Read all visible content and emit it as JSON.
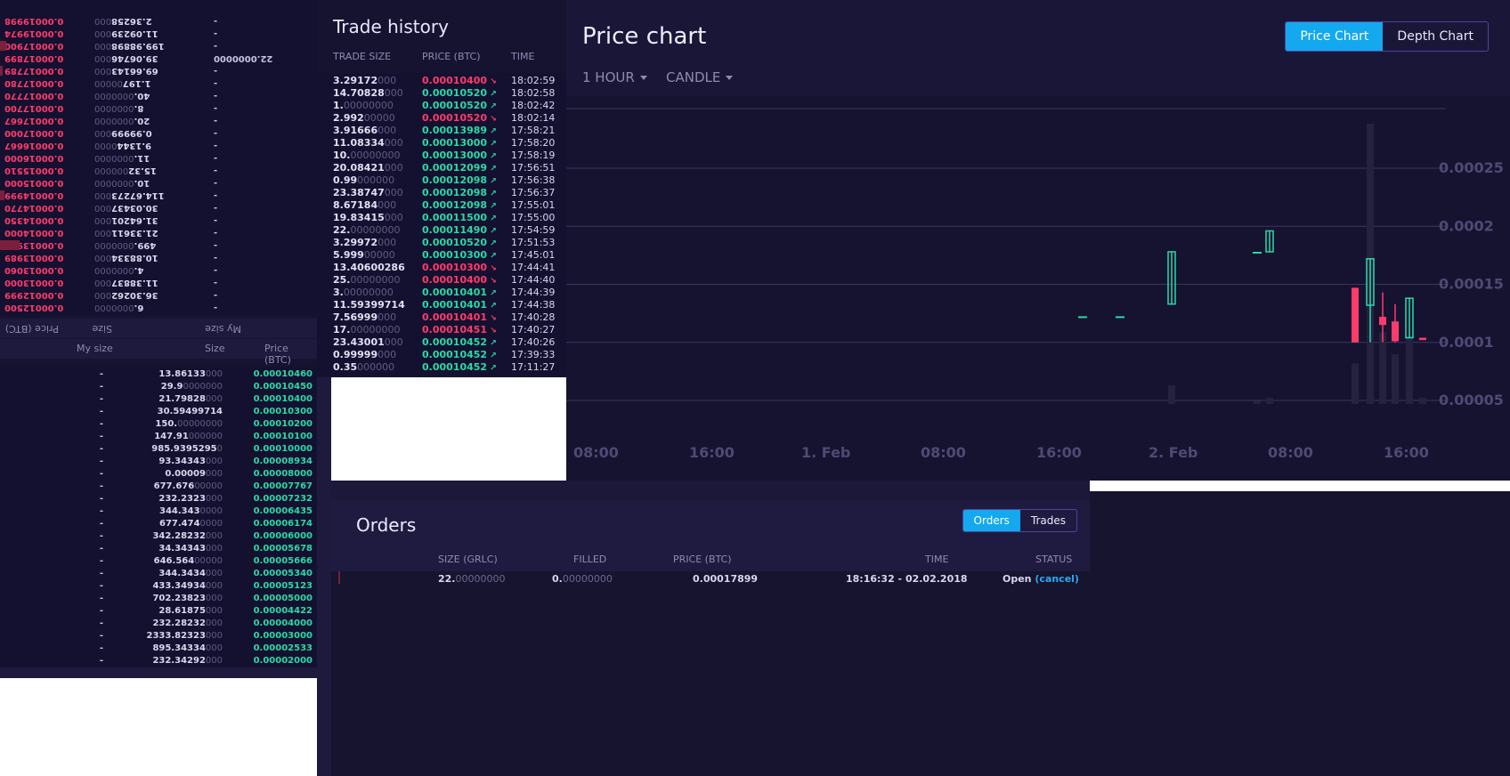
{
  "orderbook": {
    "header_flipped": {
      "price": "Price (BTC)",
      "size": "Size",
      "my_size": "My size"
    },
    "header": {
      "my_size": "My size",
      "size": "Size",
      "price": "Price (BTC)"
    },
    "asks": [
      {
        "my": "-",
        "size_b": "2.36258",
        "size_d": "000",
        "price_b": "0.0001",
        "price_d": "9998"
      },
      {
        "my": "-",
        "size_b": "11.09239",
        "size_d": "000",
        "price_b": "0.0001",
        "price_d": "9974"
      },
      {
        "my": "-",
        "size_b": "199.98898",
        "size_d": "000",
        "price_b": "0.0001",
        "price_d": "7900"
      },
      {
        "my": "22.0000000",
        "size_b": "39.06746",
        "size_d": "000",
        "price_b": "0.0001",
        "price_d": "7899"
      },
      {
        "my": "-",
        "size_b": "69.66143",
        "size_d": "000",
        "price_b": "0.0001",
        "price_d": "7789"
      },
      {
        "my": "-",
        "size_b": "1.197",
        "size_d": "00000",
        "price_b": "0.0001",
        "price_d": "7780"
      },
      {
        "my": "-",
        "size_b": "40.",
        "size_d": "0000000",
        "price_b": "0.0001",
        "price_d": "7770"
      },
      {
        "my": "-",
        "size_b": "8.",
        "size_d": "0000000",
        "price_b": "0.0001",
        "price_d": "7700"
      },
      {
        "my": "-",
        "size_b": "20.",
        "size_d": "0000000",
        "price_b": "0.0001",
        "price_d": "7667"
      },
      {
        "my": "-",
        "size_b": "0.99999",
        "size_d": "000",
        "price_b": "0.0001",
        "price_d": "7000"
      },
      {
        "my": "-",
        "size_b": "9.1344",
        "size_d": "0000",
        "price_b": "0.0001",
        "price_d": "6667"
      },
      {
        "my": "-",
        "size_b": "11.",
        "size_d": "0000000",
        "price_b": "0.0001",
        "price_d": "6000"
      },
      {
        "my": "-",
        "size_b": "15.32",
        "size_d": "000000",
        "price_b": "0.0001",
        "price_d": "5510"
      },
      {
        "my": "-",
        "size_b": "10.",
        "size_d": "0000000",
        "price_b": "0.0001",
        "price_d": "5000"
      },
      {
        "my": "-",
        "size_b": "114.67273",
        "size_d": "000",
        "price_b": "0.0001",
        "price_d": "4999"
      },
      {
        "my": "-",
        "size_b": "30.03437",
        "size_d": "000",
        "price_b": "0.0001",
        "price_d": "4770"
      },
      {
        "my": "-",
        "size_b": "31.64201",
        "size_d": "000",
        "price_b": "0.0001",
        "price_d": "4350"
      },
      {
        "my": "-",
        "size_b": "21.33611",
        "size_d": "000",
        "price_b": "0.0001",
        "price_d": "4000"
      },
      {
        "my": "-",
        "size_b": "499.",
        "size_d": "0000000",
        "price_b": "0.0001",
        "price_d": "3990"
      },
      {
        "my": "-",
        "size_b": "10.88334",
        "size_d": "000",
        "price_b": "0.0001",
        "price_d": "3989"
      },
      {
        "my": "-",
        "size_b": "4.",
        "size_d": "0000000",
        "price_b": "0.0001",
        "price_d": "3060"
      },
      {
        "my": "-",
        "size_b": "11.38837",
        "size_d": "000",
        "price_b": "0.0001",
        "price_d": "3000"
      },
      {
        "my": "-",
        "size_b": "36.30262",
        "size_d": "000",
        "price_b": "0.0001",
        "price_d": "2999"
      },
      {
        "my": "-",
        "size_b": "6.",
        "size_d": "0000000",
        "price_b": "0.0001",
        "price_d": "2500"
      }
    ],
    "bids": [
      {
        "my": "-",
        "size_b": "13.86133",
        "size_d": "000",
        "price_b": "0.0001",
        "price_d": "0460"
      },
      {
        "my": "-",
        "size_b": "29.9",
        "size_d": "0000000",
        "price_b": "0.0001",
        "price_d": "0450"
      },
      {
        "my": "-",
        "size_b": "21.79828",
        "size_d": "000",
        "price_b": "0.0001",
        "price_d": "0400"
      },
      {
        "my": "-",
        "size_b": "30.59499714",
        "size_d": "",
        "price_b": "0.0001",
        "price_d": "0300"
      },
      {
        "my": "-",
        "size_b": "150.",
        "size_d": "00000000",
        "price_b": "0.0001",
        "price_d": "0200"
      },
      {
        "my": "-",
        "size_b": "147.91",
        "size_d": "000000",
        "price_b": "0.0001",
        "price_d": "0100"
      },
      {
        "my": "-",
        "size_b": "985.9395295",
        "size_d": "0",
        "price_b": "0.0001",
        "price_d": "0000"
      },
      {
        "my": "-",
        "size_b": "93.34343",
        "size_d": "000",
        "price_b": "0.0000",
        "price_d": "8934"
      },
      {
        "my": "-",
        "size_b": "0.00009",
        "size_d": "000",
        "price_b": "0.0000",
        "price_d": "8000"
      },
      {
        "my": "-",
        "size_b": "677.676",
        "size_d": "00000",
        "price_b": "0.0000",
        "price_d": "7767"
      },
      {
        "my": "-",
        "size_b": "232.2323",
        "size_d": "000",
        "price_b": "0.0000",
        "price_d": "7232"
      },
      {
        "my": "-",
        "size_b": "344.343",
        "size_d": "0000",
        "price_b": "0.0000",
        "price_d": "6435"
      },
      {
        "my": "-",
        "size_b": "677.474",
        "size_d": "0000",
        "price_b": "0.0000",
        "price_d": "6174"
      },
      {
        "my": "-",
        "size_b": "342.28232",
        "size_d": "000",
        "price_b": "0.0000",
        "price_d": "6000"
      },
      {
        "my": "-",
        "size_b": "34.34343",
        "size_d": "000",
        "price_b": "0.0000",
        "price_d": "5678"
      },
      {
        "my": "-",
        "size_b": "646.564",
        "size_d": "00000",
        "price_b": "0.0000",
        "price_d": "5666"
      },
      {
        "my": "-",
        "size_b": "344.3434",
        "size_d": "000",
        "price_b": "0.0000",
        "price_d": "5340"
      },
      {
        "my": "-",
        "size_b": "433.34934",
        "size_d": "000",
        "price_b": "0.0000",
        "price_d": "5123"
      },
      {
        "my": "-",
        "size_b": "702.23823",
        "size_d": "000",
        "price_b": "0.0000",
        "price_d": "5000"
      },
      {
        "my": "-",
        "size_b": "28.61875",
        "size_d": "000",
        "price_b": "0.0000",
        "price_d": "4422"
      },
      {
        "my": "-",
        "size_b": "232.28232",
        "size_d": "000",
        "price_b": "0.0000",
        "price_d": "4000"
      },
      {
        "my": "-",
        "size_b": "2333.82323",
        "size_d": "000",
        "price_b": "0.0000",
        "price_d": "3000"
      },
      {
        "my": "-",
        "size_b": "895.34334",
        "size_d": "000",
        "price_b": "0.0000",
        "price_d": "2533"
      },
      {
        "my": "-",
        "size_b": "232.34292",
        "size_d": "000",
        "price_b": "0.0000",
        "price_d": "2000"
      }
    ]
  },
  "trade_history": {
    "title": "Trade history",
    "columns": {
      "size": "TRADE SIZE",
      "price": "PRICE (BTC)",
      "time": "TIME"
    },
    "rows": [
      {
        "size_b": "3.29172",
        "size_d": "000",
        "price": "0.00010400",
        "side": "sell",
        "time": "18:02:59"
      },
      {
        "size_b": "14.70828",
        "size_d": "000",
        "price": "0.00010520",
        "side": "buy",
        "time": "18:02:58"
      },
      {
        "size_b": "1.",
        "size_d": "00000000",
        "price": "0.00010520",
        "side": "buy",
        "time": "18:02:42"
      },
      {
        "size_b": "2.992",
        "size_d": "00000",
        "price": "0.00010520",
        "side": "sell",
        "time": "18:02:14"
      },
      {
        "size_b": "3.91666",
        "size_d": "000",
        "price": "0.00013989",
        "side": "buy",
        "time": "17:58:21"
      },
      {
        "size_b": "11.08334",
        "size_d": "000",
        "price": "0.00013000",
        "side": "buy",
        "time": "17:58:20"
      },
      {
        "size_b": "10.",
        "size_d": "00000000",
        "price": "0.00013000",
        "side": "buy",
        "time": "17:58:19"
      },
      {
        "size_b": "20.08421",
        "size_d": "000",
        "price": "0.00012099",
        "side": "buy",
        "time": "17:56:51"
      },
      {
        "size_b": "0.99",
        "size_d": "000000",
        "price": "0.00012098",
        "side": "buy",
        "time": "17:56:38"
      },
      {
        "size_b": "23.38747",
        "size_d": "000",
        "price": "0.00012098",
        "side": "buy",
        "time": "17:56:37"
      },
      {
        "size_b": "8.67184",
        "size_d": "000",
        "price": "0.00012098",
        "side": "buy",
        "time": "17:55:01"
      },
      {
        "size_b": "19.83415",
        "size_d": "000",
        "price": "0.00011500",
        "side": "buy",
        "time": "17:55:00"
      },
      {
        "size_b": "22.",
        "size_d": "00000000",
        "price": "0.00011490",
        "side": "buy",
        "time": "17:54:59"
      },
      {
        "size_b": "3.29972",
        "size_d": "000",
        "price": "0.00010520",
        "side": "buy",
        "time": "17:51:53"
      },
      {
        "size_b": "5.999",
        "size_d": "00000",
        "price": "0.00010300",
        "side": "buy",
        "time": "17:45:01"
      },
      {
        "size_b": "13.40600286",
        "size_d": "",
        "price": "0.00010300",
        "side": "sell",
        "time": "17:44:41"
      },
      {
        "size_b": "25.",
        "size_d": "00000000",
        "price": "0.00010400",
        "side": "sell",
        "time": "17:44:40"
      },
      {
        "size_b": "3.",
        "size_d": "00000000",
        "price": "0.00010401",
        "side": "buy",
        "time": "17:44:39"
      },
      {
        "size_b": "11.59399714",
        "size_d": "",
        "price": "0.00010401",
        "side": "buy",
        "time": "17:44:38"
      },
      {
        "size_b": "7.56999",
        "size_d": "000",
        "price": "0.00010401",
        "side": "sell",
        "time": "17:40:28"
      },
      {
        "size_b": "17.",
        "size_d": "00000000",
        "price": "0.00010451",
        "side": "sell",
        "time": "17:40:27"
      },
      {
        "size_b": "23.43001",
        "size_d": "000",
        "price": "0.00010452",
        "side": "buy",
        "time": "17:40:26"
      },
      {
        "size_b": "0.99999",
        "size_d": "000",
        "price": "0.00010452",
        "side": "buy",
        "time": "17:39:33"
      },
      {
        "size_b": "0.35",
        "size_d": "000000",
        "price": "0.00010452",
        "side": "buy",
        "time": "17:11:27"
      }
    ]
  },
  "price_chart": {
    "title": "Price chart",
    "tabs": {
      "price": "Price Chart",
      "depth": "Depth Chart"
    },
    "interval": "1 HOUR",
    "style": "CANDLE",
    "colors": {
      "up": "#2bd9a7",
      "down": "#ff3b6b",
      "grid": "#3a3660",
      "volume": "#25223f"
    }
  },
  "chart_data": {
    "type": "candlestick",
    "x_tick_labels": [
      "08:00",
      "16:00",
      "1. Feb",
      "08:00",
      "16:00",
      "2. Feb",
      "08:00",
      "16:00"
    ],
    "y_tick_labels": [
      "0.00005",
      "0.0001",
      "0.00015",
      "0.0002",
      "0.00025"
    ],
    "ylim": [
      5e-05,
      0.00025
    ],
    "candles": [
      {
        "t": 36,
        "open": 0.0001225,
        "close": 0.0001225,
        "high": 0.0001225,
        "low": 0.0001225,
        "volume": 0
      },
      {
        "t": 41,
        "open": 0.0001225,
        "close": 0.0001225,
        "high": 0.0001225,
        "low": 0.0001225,
        "volume": 0
      },
      {
        "t": 48,
        "open": 0.000133,
        "close": 0.000178,
        "high": 0.000178,
        "low": 0.000133,
        "volume": 0.6
      },
      {
        "t": 56,
        "open": 0.000178,
        "close": 0.000178,
        "high": 0.000178,
        "low": 0.000178,
        "volume": 0.1
      },
      {
        "t": 57,
        "open": 0.000178,
        "close": 0.000196,
        "high": 0.000196,
        "low": 0.000178,
        "volume": 0.2
      },
      {
        "t": 63,
        "open": 0.000147,
        "close": 0.0001,
        "high": 0.000147,
        "low": 0.0001,
        "volume": 1.3
      },
      {
        "t": 64,
        "open": 0.000132,
        "close": 0.000172,
        "high": 0.000172,
        "low": 0.0001,
        "volume": 9.0
      },
      {
        "t": 65,
        "open": 0.000122,
        "close": 0.000115,
        "high": 0.000143,
        "low": 0.0001,
        "volume": 2.3
      },
      {
        "t": 66,
        "open": 0.000118,
        "close": 0.000101,
        "high": 0.000133,
        "low": 0.0001,
        "volume": 1.6
      },
      {
        "t": 67,
        "open": 0.000104,
        "close": 0.000138,
        "high": 0.000138,
        "low": 0.000104,
        "volume": 2.2
      },
      {
        "t": 68,
        "open": 0.000104,
        "close": 0.000102,
        "high": 0.000104,
        "low": 0.000102,
        "volume": 0.2
      }
    ]
  },
  "orders": {
    "title": "Orders",
    "tabs": {
      "orders": "Orders",
      "trades": "Trades"
    },
    "columns": {
      "size": "SIZE (GRLC)",
      "filled": "FILLED",
      "price": "PRICE (BTC)",
      "time": "TIME",
      "status": "STATUS"
    },
    "rows": [
      {
        "size_b": "22.",
        "size_d": "00000000",
        "filled_b": "0.",
        "filled_d": "00000000",
        "price": "0.00017899",
        "time": "18:16:32 - 02.02.2018",
        "status": "Open",
        "cancel": "(cancel)"
      }
    ]
  }
}
